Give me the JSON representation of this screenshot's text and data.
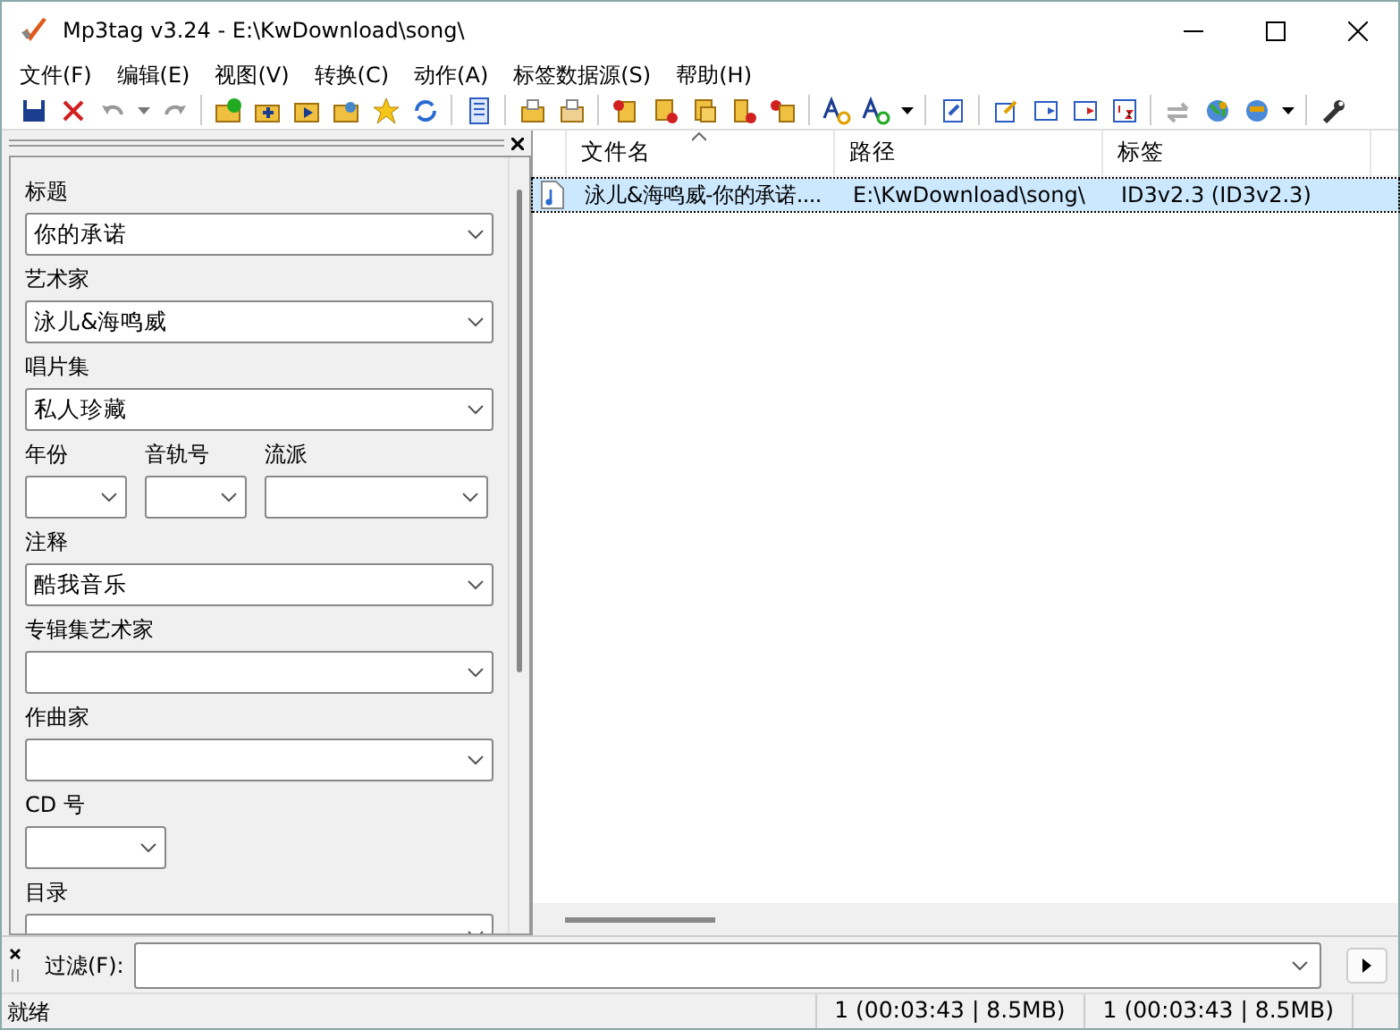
{
  "window": {
    "title": "Mp3tag v3.24  -  E:\\KwDownload\\song\\"
  },
  "menu": [
    "文件(F)",
    "编辑(E)",
    "视图(V)",
    "转换(C)",
    "动作(A)",
    "标签数据源(S)",
    "帮助(H)"
  ],
  "tag_panel": {
    "fields": [
      {
        "kind": "wide",
        "label": "标题",
        "value": "你的承诺"
      },
      {
        "kind": "wide",
        "label": "艺术家",
        "value": "泳儿&海鸣威"
      },
      {
        "kind": "wide",
        "label": "唱片集",
        "value": "私人珍藏"
      },
      {
        "kind": "row",
        "fields": [
          {
            "kind": "short",
            "label": "年份"
          },
          {
            "kind": "short",
            "label": "音轨号"
          },
          {
            "kind": "medium",
            "label": "流派"
          }
        ]
      },
      {
        "kind": "wide",
        "label": "注释",
        "value": "酷我音乐"
      },
      {
        "kind": "wide",
        "label": "专辑集艺术家"
      },
      {
        "kind": "wide",
        "label": "作曲家"
      },
      {
        "kind": "short",
        "label": "CD 号"
      },
      {
        "kind": "wide",
        "label": "目录"
      }
    ]
  },
  "file_list": {
    "columns": [
      {
        "label": "文件名",
        "sorted": true
      },
      {
        "label": "路径",
        "sorted": false
      },
      {
        "label": "标签",
        "sorted": false
      }
    ],
    "rows": [
      {
        "cells": [
          "泳儿&海鸣威-你的承诺....",
          "E:\\KwDownload\\song\\",
          "ID3v2.3 (ID3v2.3)"
        ],
        "selected": true
      }
    ]
  },
  "filter": {
    "label": "过滤(F):"
  },
  "status_bar": {
    "text": "就绪",
    "selected_info": "1 (00:03:43 | 8.5MB)",
    "total_info": "1 (00:03:43 | 8.5MB)"
  }
}
